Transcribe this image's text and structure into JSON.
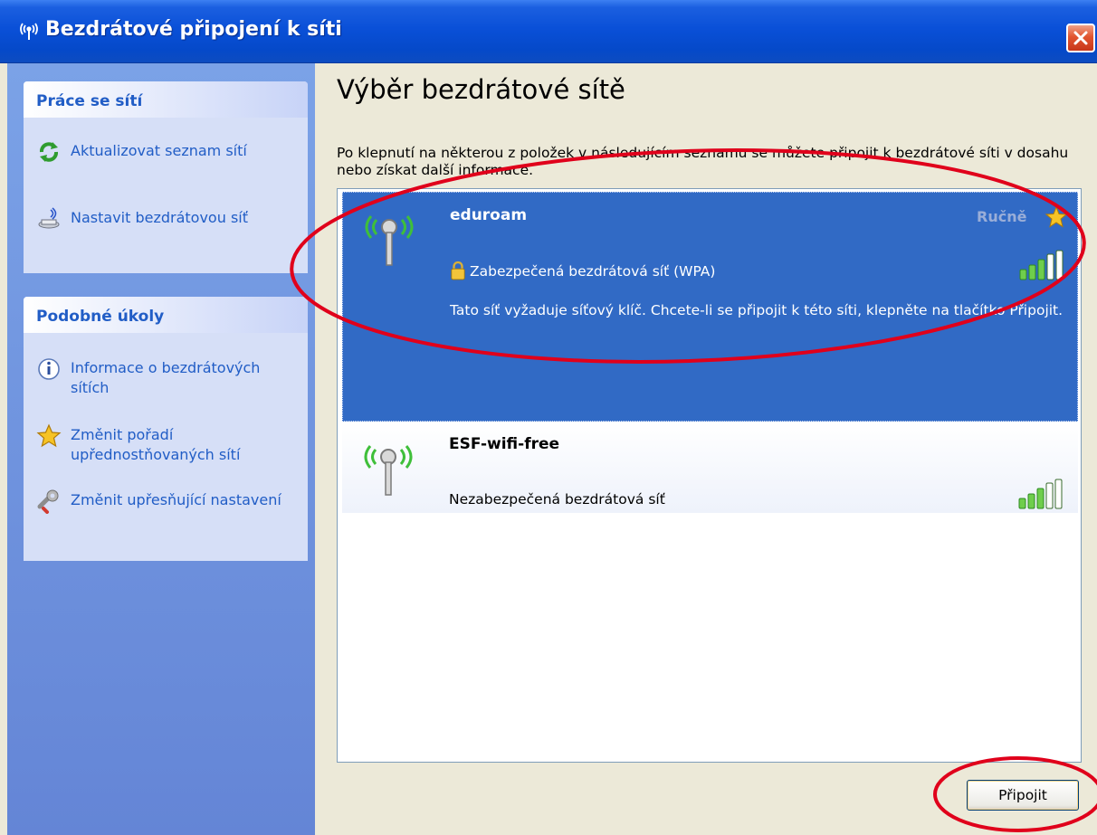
{
  "window": {
    "title": "Bezdrátové připojení k síti",
    "close_label": "Zavřít"
  },
  "sidebar": {
    "network_tasks": {
      "title": "Práce se sítí",
      "items": [
        {
          "label": "Aktualizovat seznam sítí",
          "icon": "refresh-icon"
        },
        {
          "label": "Nastavit bezdrátovou síť",
          "icon": "wireless-setup-icon"
        }
      ]
    },
    "related_tasks": {
      "title": "Podobné úkoly",
      "items": [
        {
          "label": "Informace o bezdrátových sítích",
          "icon": "info-icon"
        },
        {
          "label": "Změnit pořadí upřednostňovaných sítí",
          "icon": "star-icon"
        },
        {
          "label": "Změnit upřesňující nastavení",
          "icon": "settings-icon"
        }
      ]
    }
  },
  "main": {
    "heading": "Výběr bezdrátové sítě",
    "intro": "Po klepnutí na některou z položek v následujícím seznamu se můžete připojit k bezdrátové síti v dosahu nebo získat další informace.",
    "networks": [
      {
        "name": "eduroam",
        "preference": "Ručně",
        "security": "Zabezpečená bezdrátová síť (WPA)",
        "description": "Tato síť vyžaduje síťový klíč. Chcete-li se připojit k této síti, klepněte na tlačítko Připojit.",
        "signal_bars": 4,
        "selected": true
      },
      {
        "name": "ESF-wifi-free",
        "security": "Nezabezpečená bezdrátová síť",
        "signal_bars": 3,
        "selected": false
      }
    ],
    "connect_label": "Připojit"
  },
  "colors": {
    "titlebar": "#0a50d8",
    "taskpane": "#6d8fdc",
    "selection": "#316ac5",
    "link": "#215dc6",
    "annotation": "#e0001b"
  }
}
